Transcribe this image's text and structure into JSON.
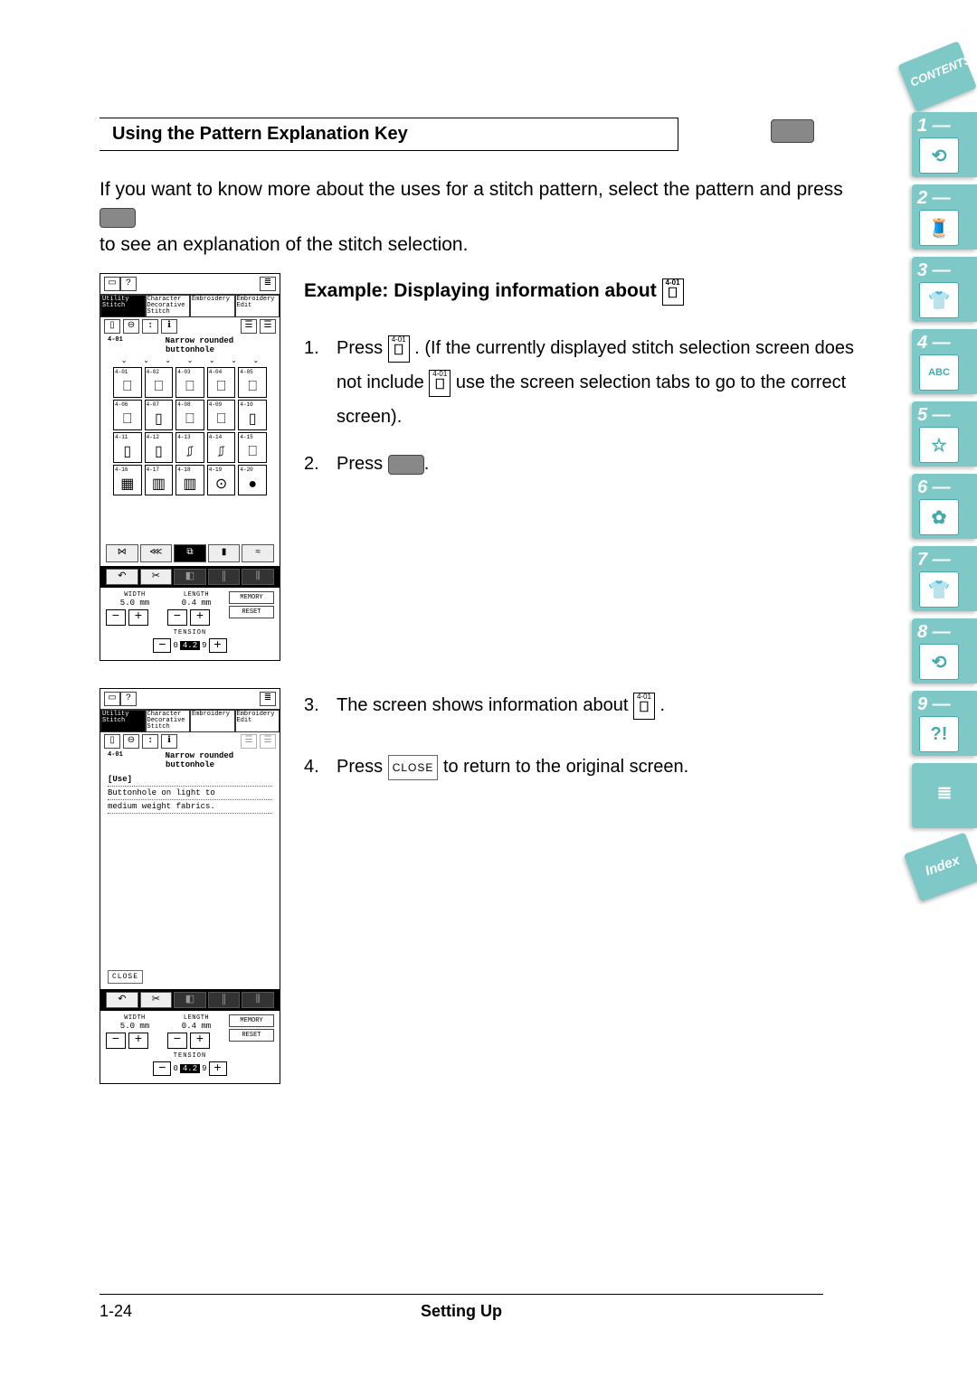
{
  "section_title": "Using the Pattern Explanation Key",
  "intro_line1": "If you want to know more about the uses for a stitch pattern, select the pattern and press ",
  "intro_line2": "to see an explanation of the stitch selection.",
  "example_title_prefix": "Example:  Displaying information about ",
  "stitch_ref": {
    "num": "4-01",
    "glyph": "⎕"
  },
  "steps": {
    "s1a": "Press ",
    "s1b": ". (If the currently displayed stitch selection screen does not include ",
    "s1c": " use the screen selection tabs to go to the correct screen).",
    "s2": "Press ",
    "s3a": "The screen shows information about ",
    "s3b": ".",
    "s4a": "Press ",
    "s4b": " to return to the original screen."
  },
  "close_label": "CLOSE",
  "lcd": {
    "tabs": [
      "Utility Stitch",
      "Character Decorative Stitch",
      "Embroidery",
      "Embroidery Edit"
    ],
    "title_line1": "Narrow rounded",
    "title_line2": "buttonhole",
    "stitch_num_left": "4-01",
    "grid": [
      [
        "4-01",
        "4-02",
        "4-03",
        "4-04",
        "4-05"
      ],
      [
        "4-06",
        "4-07",
        "4-08",
        "4-09",
        "4-10"
      ],
      [
        "4-11",
        "4-12",
        "4-13",
        "4-14",
        "4-15"
      ],
      [
        "4-16",
        "4-17",
        "4-18",
        "4-19",
        "4-20"
      ]
    ],
    "width_label": "WIDTH",
    "width_val": "5.0 mm",
    "length_label": "LENGTH",
    "length_val": "0.4 mm",
    "memory_label": "MEMORY",
    "reset_label": "RESET",
    "tension_label": "TENSION",
    "tension_lo": "0",
    "tension_val": "4.2",
    "tension_hi": "9",
    "info_hdr": "[Use]",
    "info_l1": "Buttonhole on light to",
    "info_l2": "medium weight fabrics.",
    "close": "CLOSE"
  },
  "side": {
    "contents": "CONTENTS",
    "tabs": [
      {
        "n": "1 —",
        "g": "⟲"
      },
      {
        "n": "2 —",
        "g": "🧵"
      },
      {
        "n": "3 —",
        "g": "👕"
      },
      {
        "n": "4 —",
        "g": "ABC"
      },
      {
        "n": "5 —",
        "g": "☆"
      },
      {
        "n": "6 —",
        "g": "✿"
      },
      {
        "n": "7 —",
        "g": "👕"
      },
      {
        "n": "8 —",
        "g": "⟲"
      },
      {
        "n": "9 —",
        "g": "?!"
      }
    ],
    "plain1": "≣",
    "index": "Index"
  },
  "footer": {
    "left": "1-24",
    "center": "Setting Up"
  }
}
